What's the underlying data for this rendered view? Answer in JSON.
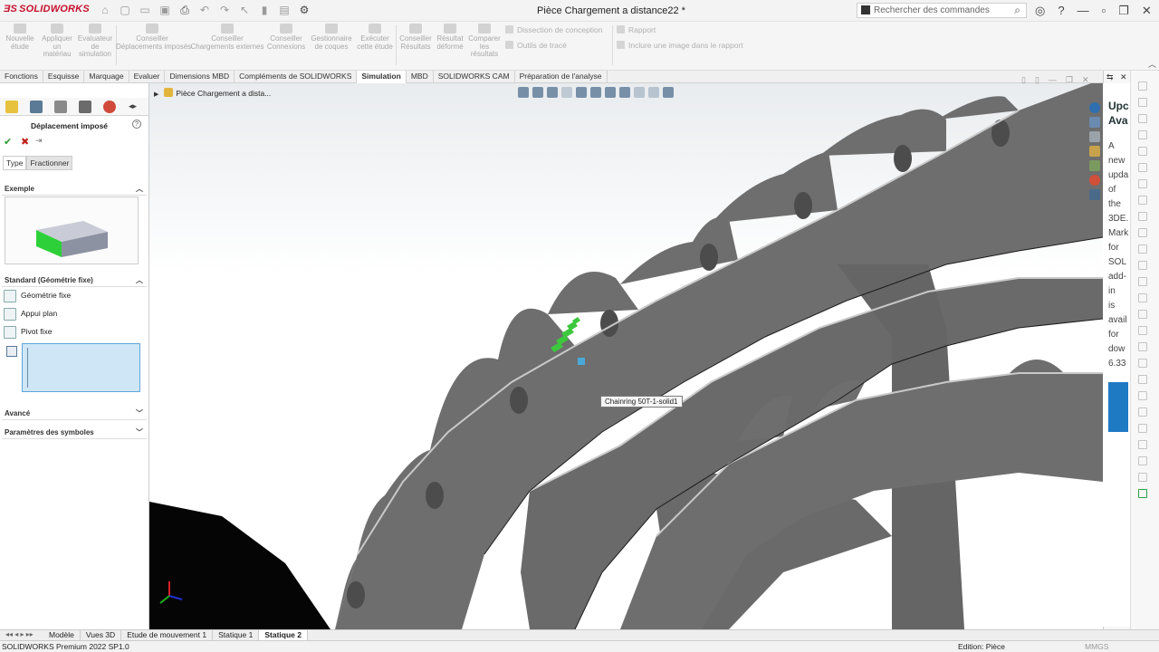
{
  "app": {
    "brand": "SOLIDWORKS",
    "doc_title": "Pièce Chargement a distance22 *"
  },
  "search": {
    "placeholder": "Rechercher des commandes"
  },
  "ribbon": {
    "buttons": [
      {
        "label": "Nouvelle\nétude"
      },
      {
        "label": "Appliquer\nun\nmatériau"
      },
      {
        "label": "Evaluateur\nde\nsimulation"
      },
      {
        "label": "Conseiller\nDéplacements imposés"
      },
      {
        "label": "Conseiller\nChargements externes"
      },
      {
        "label": "Conseiller\nConnexions"
      },
      {
        "label": "Gestionnaire\nde coques"
      },
      {
        "label": "Exécuter\ncette étude"
      },
      {
        "label": "Conseiller\nRésultats"
      },
      {
        "label": "Résultat\ndéformé"
      },
      {
        "label": "Comparer\nles\nrésultats"
      }
    ],
    "design_insight": "Dissection de conception",
    "plot_tools": "Outils de tracé",
    "report": "Rapport",
    "include_image": "Inclure une image dans le rapport"
  },
  "tabs": [
    "Fonctions",
    "Esquisse",
    "Marquage",
    "Evaluer",
    "Dimensions MBD",
    "Compléments de SOLIDWORKS",
    "Simulation",
    "MBD",
    "SOLIDWORKS CAM",
    "Préparation de l'analyse"
  ],
  "active_tab": "Simulation",
  "pm": {
    "title": "Déplacement imposé",
    "subtabs": [
      "Type",
      "Fractionner"
    ],
    "example_section": "Exemple",
    "standard_section": "Standard (Géométrie fixe)",
    "options": [
      "Géométrie fixe",
      "Appui plan",
      "Pivot fixe"
    ],
    "advanced_section": "Avancé",
    "symbol_section": "Paramètres des symboles"
  },
  "viewport": {
    "tree_root": "Pièce Chargement a dista...",
    "tooltip": "Chainring 50T-1-solid1"
  },
  "task_pane": {
    "title_lines": [
      "Upc",
      "Ava"
    ],
    "body": [
      "A",
      "new",
      "upda",
      "of",
      "the",
      "3DE.",
      "Mark",
      "for",
      "SOL",
      "add-",
      "in",
      "is",
      "avail",
      "for",
      "dow",
      "6.33"
    ]
  },
  "bottom_tabs": [
    "Modèle",
    "Vues 3D",
    "Etude de mouvement 1",
    "Statique 1",
    "Statique 2"
  ],
  "active_bottom_tab": "Statique 2",
  "status": {
    "left": "SOLIDWORKS Premium 2022 SP1.0",
    "right": "Edition: Pièce",
    "units": "MMGS"
  },
  "colors": {
    "brand": "#c8102e",
    "part_gray": "#6e6e6e",
    "fixture_green": "#3cc83c",
    "selection_blue": "#cfe6f6"
  }
}
